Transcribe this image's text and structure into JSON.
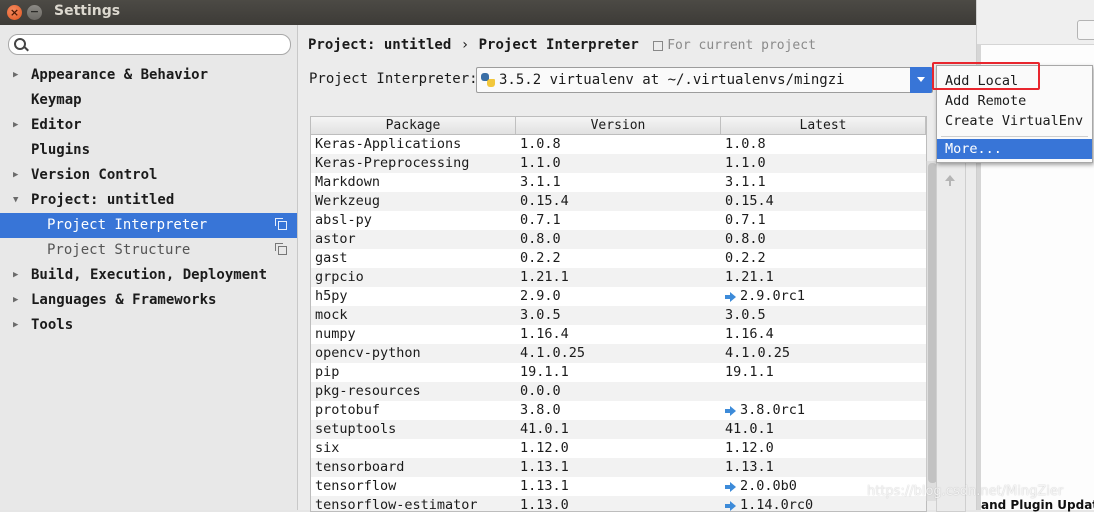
{
  "window": {
    "title": "Settings",
    "close_glyph": "×",
    "minimize_glyph": "−"
  },
  "sidebar": {
    "search_placeholder": "",
    "items": [
      {
        "label": "Appearance & Behavior",
        "arrow": "▶"
      },
      {
        "label": "Keymap",
        "arrow": ""
      },
      {
        "label": "Editor",
        "arrow": "▶"
      },
      {
        "label": "Plugins",
        "arrow": ""
      },
      {
        "label": "Version Control",
        "arrow": "▶"
      },
      {
        "label": "Project: untitled",
        "arrow": "▼"
      },
      {
        "label": "Project Interpreter",
        "arrow": ""
      },
      {
        "label": "Project Structure",
        "arrow": ""
      },
      {
        "label": "Build, Execution, Deployment",
        "arrow": "▶"
      },
      {
        "label": "Languages & Frameworks",
        "arrow": "▶"
      },
      {
        "label": "Tools",
        "arrow": "▶"
      }
    ]
  },
  "breadcrumb": {
    "project": "Project: untitled",
    "sep": "›",
    "page": "Project Interpreter",
    "note": "For current project"
  },
  "interpreter": {
    "label": "Project Interpreter:",
    "value": "3.5.2 virtualenv at ~/.virtualenvs/mingzi"
  },
  "table": {
    "headers": [
      "Package",
      "Version",
      "Latest"
    ],
    "rows": [
      [
        "Keras-Applications",
        "1.0.8",
        "1.0.8",
        false
      ],
      [
        "Keras-Preprocessing",
        "1.1.0",
        "1.1.0",
        false
      ],
      [
        "Markdown",
        "3.1.1",
        "3.1.1",
        false
      ],
      [
        "Werkzeug",
        "0.15.4",
        "0.15.4",
        false
      ],
      [
        "absl-py",
        "0.7.1",
        "0.7.1",
        false
      ],
      [
        "astor",
        "0.8.0",
        "0.8.0",
        false
      ],
      [
        "gast",
        "0.2.2",
        "0.2.2",
        false
      ],
      [
        "grpcio",
        "1.21.1",
        "1.21.1",
        false
      ],
      [
        "h5py",
        "2.9.0",
        "2.9.0rc1",
        true
      ],
      [
        "mock",
        "3.0.5",
        "3.0.5",
        false
      ],
      [
        "numpy",
        "1.16.4",
        "1.16.4",
        false
      ],
      [
        "opencv-python",
        "4.1.0.25",
        "4.1.0.25",
        false
      ],
      [
        "pip",
        "19.1.1",
        "19.1.1",
        false
      ],
      [
        "pkg-resources",
        "0.0.0",
        "",
        false
      ],
      [
        "protobuf",
        "3.8.0",
        "3.8.0rc1",
        true
      ],
      [
        "setuptools",
        "41.0.1",
        "41.0.1",
        false
      ],
      [
        "six",
        "1.12.0",
        "1.12.0",
        false
      ],
      [
        "tensorboard",
        "1.13.1",
        "1.13.1",
        false
      ],
      [
        "tensorflow",
        "1.13.1",
        "2.0.0b0",
        true
      ],
      [
        "tensorflow-estimator",
        "1.13.0",
        "1.14.0rc0",
        true
      ]
    ]
  },
  "popup": {
    "items": [
      "Add Local",
      "Add Remote",
      "Create VirtualEnv",
      "More..."
    ]
  },
  "background": {
    "plugin_text": "and Plugin Updat"
  },
  "watermark": "https://blog.csdn.net/MingZier",
  "colors": {
    "selection": "#3875d7",
    "annotation": "#e8262e",
    "upgrade_arrow": "#3d8bd9"
  }
}
